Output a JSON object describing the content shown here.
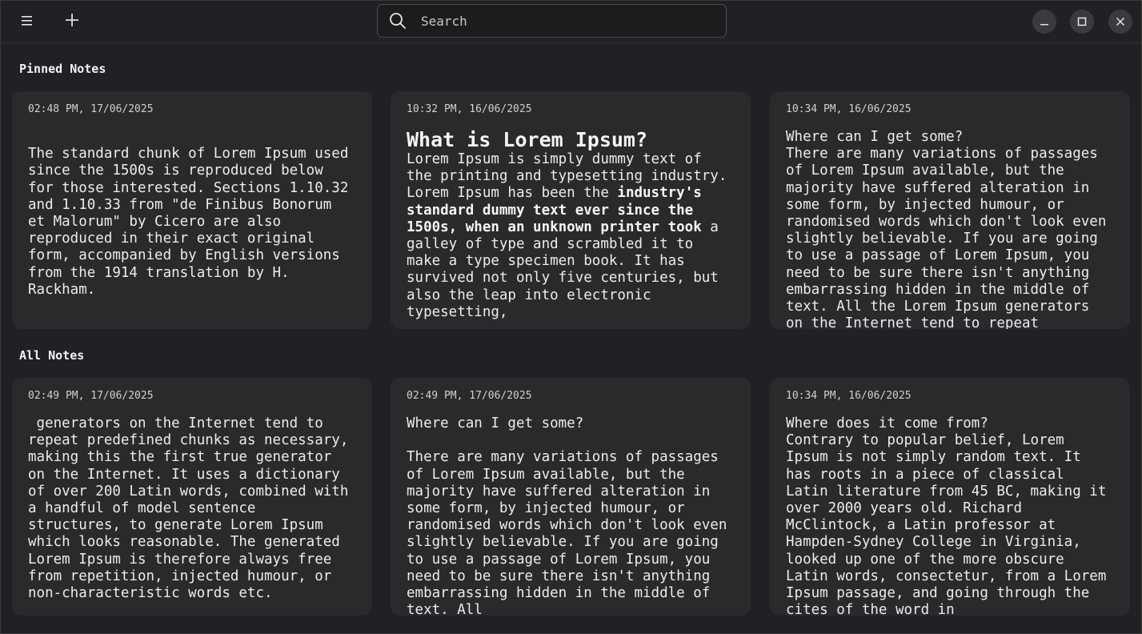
{
  "topbar": {
    "menu_icon": "menu-icon",
    "add_icon": "plus-icon",
    "search_placeholder": "Search",
    "search_icon": "search-icon",
    "minimize_icon": "minimize-icon",
    "maximize_icon": "maximize-icon",
    "close_icon": "close-icon"
  },
  "sections": {
    "pinned_title": "Pinned Notes",
    "all_title": "All Notes"
  },
  "pinned": [
    {
      "date": "02:48 PM, 17/06/2025",
      "body": "\nThe standard chunk of Lorem Ipsum used since the 1500s is reproduced below for those interested. Sections 1.10.32 and 1.10.33 from \"de Finibus Bonorum et Malorum\" by Cicero are also reproduced in their exact original form, accompanied by English versions from the 1914 translation by H. Rackham."
    },
    {
      "date": "10:32 PM, 16/06/2025",
      "headline": "What is Lorem Ipsum?",
      "body_pre": "Lorem Ipsum is simply dummy text of the printing and typesetting industry. Lorem Ipsum has been the ",
      "body_bold": "industry's standard dummy text ever since the 1500s, when an unknown printer took",
      "body_post": " a galley of type and scrambled it to make a type specimen book. It has survived not only five centuries, but also the leap into electronic typesetting,"
    },
    {
      "date": "10:34 PM, 16/06/2025",
      "body": "Where can I get some?\nThere are many variations of passages of Lorem Ipsum available, but the majority have suffered alteration in some form, by injected humour, or randomised words which don't look even slightly believable. If you are going to use a passage of Lorem Ipsum, you need to be sure there isn't anything embarrassing hidden in the middle of text. All the Lorem Ipsum generators on the Internet tend to repeat predefined chunks as necessary"
    }
  ],
  "all": [
    {
      "date": "02:49 PM, 17/06/2025",
      "body": " generators on the Internet tend to repeat predefined chunks as necessary, making this the first true generator on the Internet. It uses a dictionary of over 200 Latin words, combined with a handful of model sentence structures, to generate Lorem Ipsum which looks reasonable. The generated Lorem Ipsum is therefore always free from repetition, injected humour, or non-characteristic words etc."
    },
    {
      "date": "02:49 PM, 17/06/2025",
      "body": "Where can I get some?\n\nThere are many variations of passages of Lorem Ipsum available, but the majority have suffered alteration in some form, by injected humour, or randomised words which don't look even slightly believable. If you are going to use a passage of Lorem Ipsum, you need to be sure there isn't anything embarrassing hidden in the middle of text. All"
    },
    {
      "date": "10:34 PM, 16/06/2025",
      "body": "Where does it come from?\nContrary to popular belief, Lorem Ipsum is not simply random text. It has roots in a piece of classical Latin literature from 45 BC, making it over 2000 years old. Richard McClintock, a Latin professor at Hampden-Sydney College in Virginia, looked up one of the more obscure Latin words, consectetur, from a Lorem Ipsum passage, and going through the cites of the word in"
    }
  ]
}
